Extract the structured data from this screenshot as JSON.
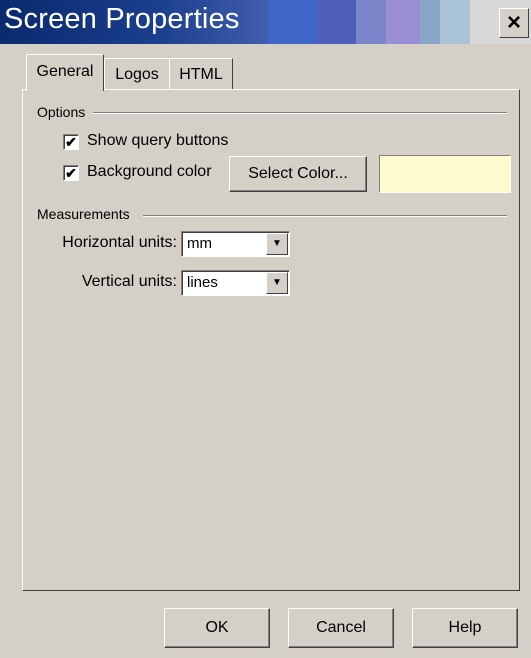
{
  "window": {
    "title": "Screen Properties",
    "close_glyph": "×",
    "titlebar_colors": [
      "#0a2a6e",
      "#1b3f8e",
      "#4a64b4",
      "#8e8fcf",
      "#9fb6cc",
      "#d8d8d8"
    ]
  },
  "tabs": [
    {
      "label": "General",
      "active": true
    },
    {
      "label": "Logos",
      "active": false
    },
    {
      "label": "HTML",
      "active": false
    }
  ],
  "options": {
    "group_label": "Options",
    "show_query_buttons": {
      "label": "Show query buttons",
      "checked": true,
      "mark": "✔"
    },
    "background_color": {
      "label": "Background color",
      "checked": true,
      "mark": "✔"
    },
    "select_color_label": "Select Color...",
    "swatch_color": "#fff9d0"
  },
  "measurements": {
    "group_label": "Measurements",
    "horizontal_label": "Horizontal units:",
    "horizontal_value": "mm",
    "vertical_label": "Vertical units:",
    "vertical_value": "lines",
    "dropdown_icon": "▼"
  },
  "buttons": {
    "ok": "OK",
    "cancel": "Cancel",
    "help": "Help"
  }
}
